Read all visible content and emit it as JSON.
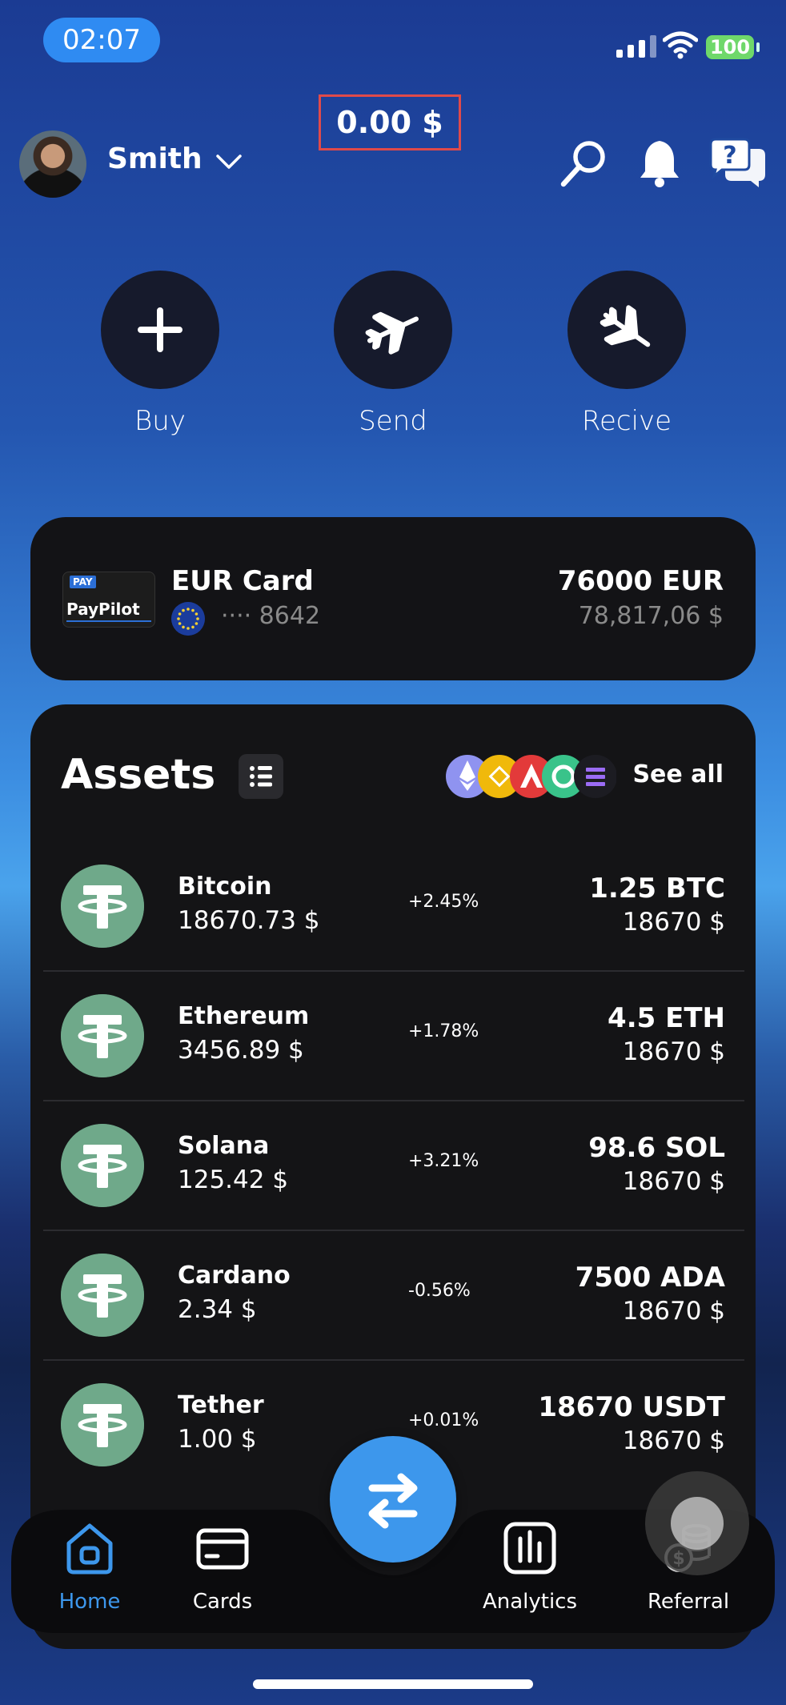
{
  "status": {
    "time": "02:07",
    "battery": "100"
  },
  "header": {
    "username": "Smith",
    "balance": "0.00 $"
  },
  "actions": [
    {
      "label": "Buy",
      "icon": "plus-icon"
    },
    {
      "label": "Send",
      "icon": "plane-takeoff-icon"
    },
    {
      "label": "Recive",
      "icon": "plane-landing-icon"
    }
  ],
  "card": {
    "logo_small": "PAY",
    "logo_text": "PayPilot",
    "title": "EUR Card",
    "number": "···· 8642",
    "amount": "76000 EUR",
    "usd": "78,817,06 $"
  },
  "assets": {
    "title": "Assets",
    "see_all": "See all",
    "items": [
      {
        "name": "Bitcoin",
        "price": "18670.73 $",
        "change": "+2.45%",
        "qty": "1.25 BTC",
        "value": "18670 $"
      },
      {
        "name": "Ethereum",
        "price": "3456.89 $",
        "change": "+1.78%",
        "qty": "4.5 ETH",
        "value": "18670 $"
      },
      {
        "name": "Solana",
        "price": "125.42 $",
        "change": "+3.21%",
        "qty": "98.6 SOL",
        "value": "18670 $"
      },
      {
        "name": "Cardano",
        "price": "2.34 $",
        "change": "-0.56%",
        "qty": "7500 ADA",
        "value": "18670 $"
      },
      {
        "name": "Tether",
        "price": "1.00 $",
        "change": "+0.01%",
        "qty": "18670 USDT",
        "value": "18670 $"
      }
    ]
  },
  "nav": {
    "home": "Home",
    "cards": "Cards",
    "analytics": "Analytics",
    "referral": "Referral"
  },
  "colors": {
    "accent": "#3d97ec",
    "panel": "#141416",
    "tether_green": "#6fa98a",
    "highlight_box": "#e04a4a"
  }
}
